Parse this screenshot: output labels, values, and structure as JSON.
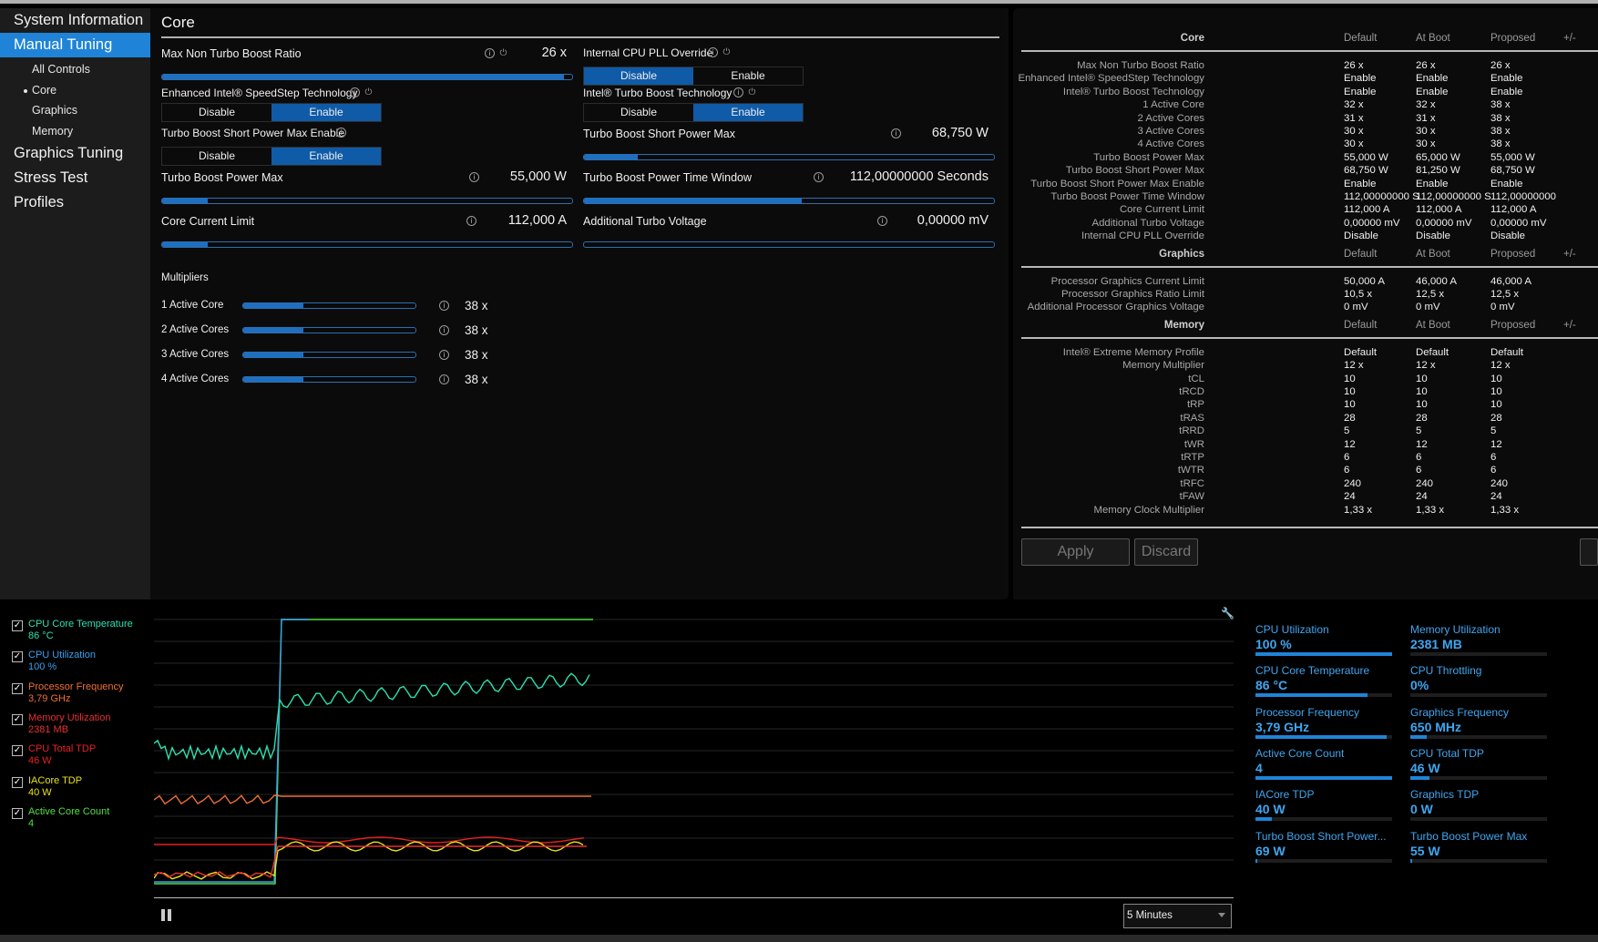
{
  "sidebar": {
    "items": [
      {
        "label": "System Information"
      },
      {
        "label": "Manual Tuning"
      },
      {
        "label": "All Controls"
      },
      {
        "label": "Core"
      },
      {
        "label": "Graphics"
      },
      {
        "label": "Memory"
      },
      {
        "label": "Graphics Tuning"
      },
      {
        "label": "Stress Test"
      },
      {
        "label": "Profiles"
      }
    ]
  },
  "core": {
    "title": "Core",
    "max_non_turbo": {
      "label": "Max Non Turbo Boost Ratio",
      "value": "26 x",
      "level": 0.98
    },
    "pll_override": {
      "label": "Internal CPU PLL Override",
      "opt1": "Disable",
      "opt2": "Enable",
      "selected": "Disable"
    },
    "speedstep": {
      "label": "Enhanced Intel® SpeedStep Technology",
      "opt1": "Disable",
      "opt2": "Enable",
      "selected": "Enable"
    },
    "turbo_boost_tech": {
      "label": "Intel® Turbo Boost Technology",
      "opt1": "Disable",
      "opt2": "Enable",
      "selected": "Enable"
    },
    "short_power_max_enable": {
      "label": "Turbo Boost Short Power Max Enable",
      "opt1": "Disable",
      "opt2": "Enable",
      "selected": "Enable"
    },
    "short_power_max": {
      "label": "Turbo Boost Short Power Max",
      "value": "68,750 W",
      "level": 0.13
    },
    "power_max": {
      "label": "Turbo Boost Power Max",
      "value": "55,000 W",
      "level": 0.11
    },
    "time_window": {
      "label": "Turbo Boost Power Time Window",
      "value": "112,00000000 Seconds",
      "level": 0.53
    },
    "current_limit": {
      "label": "Core Current Limit",
      "value": "112,000 A",
      "level": 0.11
    },
    "additional_voltage": {
      "label": "Additional Turbo Voltage",
      "value": "0,00000 mV",
      "level": 0.0
    },
    "multipliers_label": "Multipliers",
    "multipliers": [
      {
        "label": "1 Active Core",
        "value": "38 x",
        "level": 0.35
      },
      {
        "label": "2 Active Cores",
        "value": "38 x",
        "level": 0.35
      },
      {
        "label": "3 Active Cores",
        "value": "38 x",
        "level": 0.35
      },
      {
        "label": "4 Active Cores",
        "value": "38 x",
        "level": 0.35
      }
    ]
  },
  "summary": {
    "headers": {
      "default": "Default",
      "at_boot": "At Boot",
      "proposed": "Proposed",
      "diff": "+/-"
    },
    "sections": [
      {
        "name": "Core",
        "rows": [
          {
            "k": "Max Non Turbo Boost Ratio",
            "d": "26 x",
            "b": "26 x",
            "p": "26 x"
          },
          {
            "k": "Enhanced Intel® SpeedStep Technology",
            "d": "Enable",
            "b": "Enable",
            "p": "Enable"
          },
          {
            "k": "Intel® Turbo Boost Technology",
            "d": "Enable",
            "b": "Enable",
            "p": "Enable"
          },
          {
            "k": "1 Active Core",
            "d": "32 x",
            "b": "32 x",
            "p": "38 x"
          },
          {
            "k": "2 Active Cores",
            "d": "31 x",
            "b": "31 x",
            "p": "38 x"
          },
          {
            "k": "3 Active Cores",
            "d": "30 x",
            "b": "30 x",
            "p": "38 x"
          },
          {
            "k": "4 Active Cores",
            "d": "30 x",
            "b": "30 x",
            "p": "38 x"
          },
          {
            "k": "Turbo Boost Power Max",
            "d": "55,000 W",
            "b": "65,000 W",
            "p": "55,000 W"
          },
          {
            "k": "Turbo Boost Short Power Max",
            "d": "68,750 W",
            "b": "81,250 W",
            "p": "68,750 W"
          },
          {
            "k": "Turbo Boost Short Power Max Enable",
            "d": "Enable",
            "b": "Enable",
            "p": "Enable"
          },
          {
            "k": "Turbo Boost Power Time Window",
            "d": "112,00000000 S",
            "b": "112,00000000 S",
            "p": "112,00000000"
          },
          {
            "k": "Core Current Limit",
            "d": "112,000 A",
            "b": "112,000 A",
            "p": "112,000 A"
          },
          {
            "k": "Additional Turbo Voltage",
            "d": "0,00000 mV",
            "b": "0,00000 mV",
            "p": "0,00000 mV"
          },
          {
            "k": "Internal CPU PLL Override",
            "d": "Disable",
            "b": "Disable",
            "p": "Disable"
          }
        ]
      },
      {
        "name": "Graphics",
        "rows": [
          {
            "k": "Processor Graphics Current Limit",
            "d": "50,000 A",
            "b": "46,000 A",
            "p": "46,000 A"
          },
          {
            "k": "Processor Graphics Ratio Limit",
            "d": "10,5 x",
            "b": "12,5 x",
            "p": "12,5 x"
          },
          {
            "k": "Additional Processor Graphics Voltage",
            "d": "0 mV",
            "b": "0 mV",
            "p": "0 mV"
          }
        ]
      },
      {
        "name": "Memory",
        "rows": [
          {
            "k": "Intel® Extreme Memory Profile",
            "d": "Default",
            "b": "Default",
            "p": "Default"
          },
          {
            "k": "Memory Multiplier",
            "d": "12 x",
            "b": "12 x",
            "p": "12 x"
          },
          {
            "k": "tCL",
            "d": "10",
            "b": "10",
            "p": "10"
          },
          {
            "k": "tRCD",
            "d": "10",
            "b": "10",
            "p": "10"
          },
          {
            "k": "tRP",
            "d": "10",
            "b": "10",
            "p": "10"
          },
          {
            "k": "tRAS",
            "d": "28",
            "b": "28",
            "p": "28"
          },
          {
            "k": "tRRD",
            "d": "5",
            "b": "5",
            "p": "5"
          },
          {
            "k": "tWR",
            "d": "12",
            "b": "12",
            "p": "12"
          },
          {
            "k": "tRTP",
            "d": "6",
            "b": "6",
            "p": "6"
          },
          {
            "k": "tWTR",
            "d": "6",
            "b": "6",
            "p": "6"
          },
          {
            "k": "tRFC",
            "d": "240",
            "b": "240",
            "p": "240"
          },
          {
            "k": "tFAW",
            "d": "24",
            "b": "24",
            "p": "24"
          },
          {
            "k": "Memory Clock Multiplier",
            "d": "1,33 x",
            "b": "1,33 x",
            "p": "1,33 x"
          }
        ]
      }
    ],
    "apply_label": "Apply",
    "discard_label": "Discard"
  },
  "monitor": {
    "legend": [
      {
        "name": "CPU Core Temperature",
        "value": "86 °C",
        "color": "#2ee0b0"
      },
      {
        "name": "CPU Utilization",
        "value": "100 %",
        "color": "#3aa0f0"
      },
      {
        "name": "Processor Frequency",
        "value": "3,79 GHz",
        "color": "#f07030"
      },
      {
        "name": "Memory Utilization",
        "value": "2381  MB",
        "color": "#e83030"
      },
      {
        "name": "CPU Total TDP",
        "value": "46 W",
        "color": "#e82020"
      },
      {
        "name": "IACore TDP",
        "value": "40 W",
        "color": "#e8e020"
      },
      {
        "name": "Active Core Count",
        "value": "4",
        "color": "#50e040"
      }
    ],
    "tiles": [
      {
        "name": "CPU Utilization",
        "value": "100 %",
        "level": 1.0
      },
      {
        "name": "Memory Utilization",
        "value": "2381  MB",
        "level": 0.0
      },
      {
        "name": "CPU Core Temperature",
        "value": "86 °C",
        "level": 0.82
      },
      {
        "name": "CPU Throttling",
        "value": "0%",
        "level": 0.0
      },
      {
        "name": "Processor Frequency",
        "value": "3,79 GHz",
        "level": 0.96
      },
      {
        "name": "Graphics Frequency",
        "value": "650 MHz",
        "level": 0.12
      },
      {
        "name": "Active Core Count",
        "value": "4",
        "level": 1.0
      },
      {
        "name": "CPU Total TDP",
        "value": "46 W",
        "level": 0.14
      },
      {
        "name": "IACore TDP",
        "value": "40 W",
        "level": 0.12
      },
      {
        "name": "Graphics TDP",
        "value": "0 W",
        "level": 0.0
      },
      {
        "name": "Turbo Boost Short Power...",
        "value": "69 W",
        "level": 0.01
      },
      {
        "name": "Turbo Boost Power Max",
        "value": "55 W",
        "level": 0.01
      }
    ],
    "time_range": "5 Minutes"
  }
}
